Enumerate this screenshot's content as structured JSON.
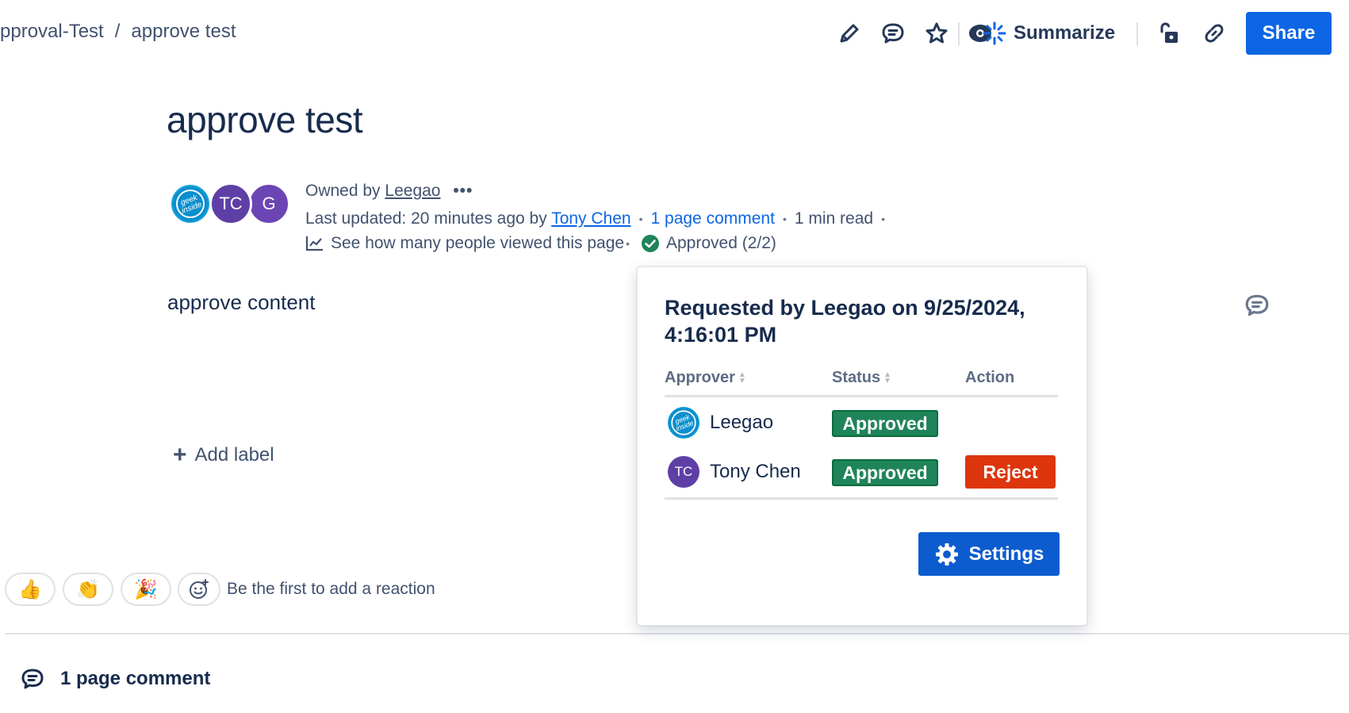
{
  "breadcrumb": {
    "space": "pproval-Test",
    "separator": "/",
    "page": "approve test"
  },
  "toolbar": {
    "icons": [
      "pencil-icon",
      "comment-icon",
      "star-icon",
      "watch-icon",
      "restrictions-icon",
      "link-icon"
    ],
    "summarize_label": "Summarize",
    "share_label": "Share",
    "accent": "#0c66e4"
  },
  "page": {
    "title": "approve test",
    "avatars": [
      "TC",
      "G"
    ],
    "owned_by_prefix": "Owned by",
    "owner": "Leegao",
    "more": "•••",
    "last_updated": "Last updated: 20 minutes ago by",
    "updated_by": "Tony Chen",
    "comment_link": "1 page comment",
    "read_time": "1 min read",
    "dot": "•",
    "analytics": "See how many people viewed this page",
    "approval_status": "Approved (2/2)",
    "content": "approve content",
    "add_label": "Add label"
  },
  "reactions": {
    "items": [
      "👍",
      "👏",
      "🎉"
    ],
    "hint": "Be the first to add a reaction"
  },
  "comments": {
    "heading": "1 page comment"
  },
  "approval_popover": {
    "title": "Requested by Leegao on 9/25/2024, 4:16:01 PM",
    "columns": {
      "approver": "Approver",
      "status": "Status",
      "action": "Action"
    },
    "rows": [
      {
        "approver": "Leegao",
        "avatar": "geek inside",
        "status": "Approved",
        "action": ""
      },
      {
        "approver": "Tony Chen",
        "avatar": "TC",
        "status": "Approved",
        "action": "Reject"
      }
    ],
    "settings_label": "Settings",
    "status_color": "#1f845a",
    "reject_color": "#dd350d"
  }
}
